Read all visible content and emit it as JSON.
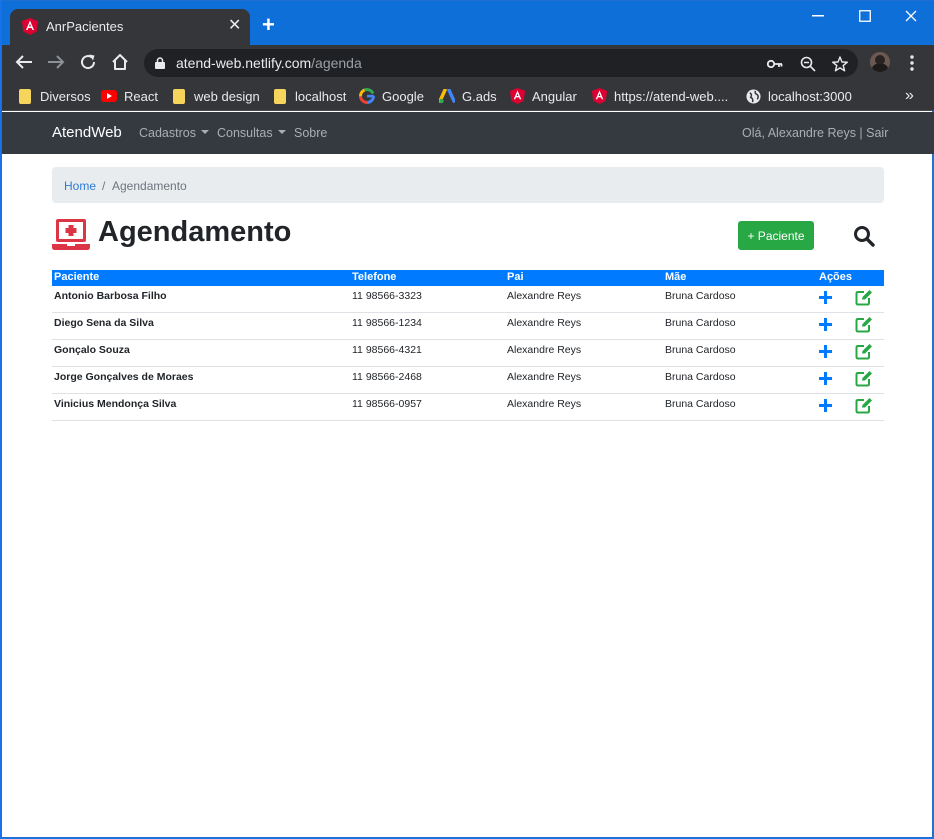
{
  "browser": {
    "tab_title": "AnrPacientes",
    "url_host": "atend-web.netlify.com",
    "url_path": "/agenda",
    "bookmarks": [
      {
        "label": "Diversos",
        "icon": "folder-icon"
      },
      {
        "label": "React",
        "icon": "youtube-icon"
      },
      {
        "label": "web design",
        "icon": "folder-icon"
      },
      {
        "label": "localhost",
        "icon": "folder-icon"
      },
      {
        "label": "Google",
        "icon": "google-icon"
      },
      {
        "label": "G.ads",
        "icon": "google-ads-icon"
      },
      {
        "label": "Angular",
        "icon": "angular-icon"
      },
      {
        "label": "https://atend-web....",
        "icon": "angular-icon"
      },
      {
        "label": "localhost:3000",
        "icon": "globe-icon"
      }
    ],
    "more_bookmarks": "»"
  },
  "navbar": {
    "brand": "AtendWeb",
    "links": [
      "Cadastros",
      "Consultas",
      "Sobre"
    ],
    "user_text": "Olá, Alexandre Reys | Sair"
  },
  "breadcrumb": {
    "home": "Home",
    "separator": "/",
    "current": "Agendamento"
  },
  "page": {
    "title": "Agendamento",
    "add_button": "+ Paciente"
  },
  "table": {
    "headers": [
      "Paciente",
      "Telefone",
      "Pai",
      "Mãe",
      "Ações"
    ],
    "rows": [
      [
        "Antonio Barbosa Filho",
        "11 98566-3323",
        "Alexandre Reys",
        "Bruna Cardoso"
      ],
      [
        "Diego Sena da Silva",
        "11 98566-1234",
        "Alexandre Reys",
        "Bruna Cardoso"
      ],
      [
        "Gonçalo Souza",
        "11 98566-4321",
        "Alexandre Reys",
        "Bruna Cardoso"
      ],
      [
        "Jorge Gonçalves de Moraes",
        "11 98566-2468",
        "Alexandre Reys",
        "Bruna Cardoso"
      ],
      [
        "Vinicius Mendonça Silva",
        "11 98566-0957",
        "Alexandre Reys",
        "Bruna Cardoso"
      ]
    ]
  },
  "colors": {
    "primary": "#007bff",
    "success": "#28a745",
    "danger": "#dc3545",
    "navbar": "#343a40",
    "chrome_frame": "#0f6fd8"
  }
}
